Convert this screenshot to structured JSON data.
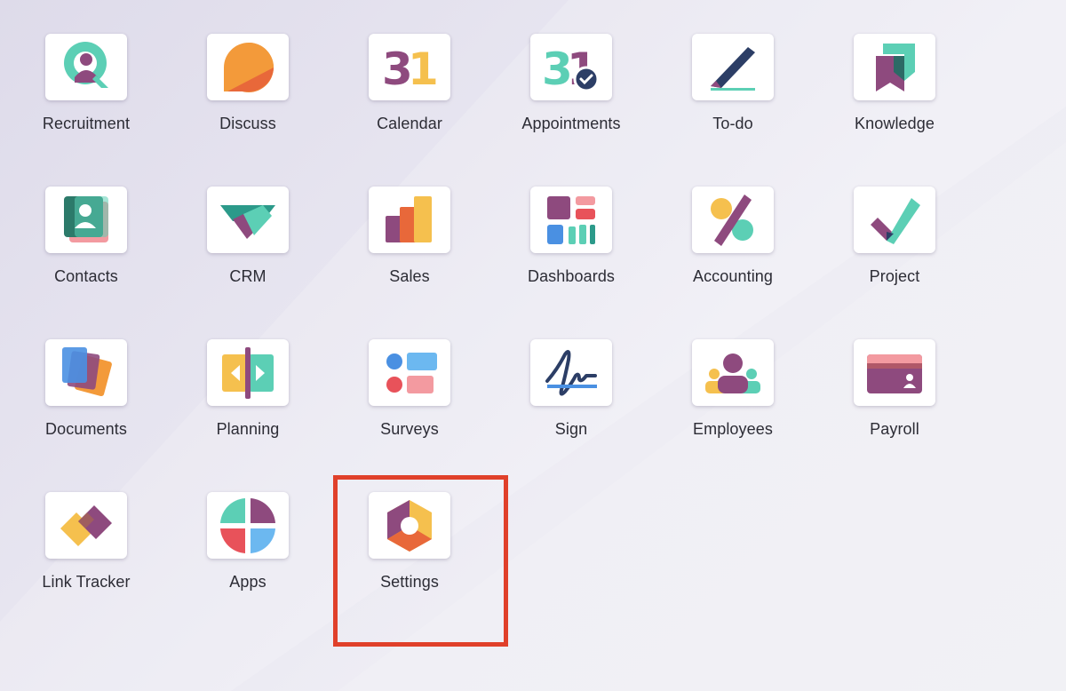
{
  "apps": [
    {
      "id": "recruitment",
      "label": "Recruitment",
      "icon": "recruitment-icon"
    },
    {
      "id": "discuss",
      "label": "Discuss",
      "icon": "discuss-icon"
    },
    {
      "id": "calendar",
      "label": "Calendar",
      "icon": "calendar-icon"
    },
    {
      "id": "appointments",
      "label": "Appointments",
      "icon": "appointments-icon"
    },
    {
      "id": "todo",
      "label": "To-do",
      "icon": "todo-icon"
    },
    {
      "id": "knowledge",
      "label": "Knowledge",
      "icon": "knowledge-icon"
    },
    {
      "id": "contacts",
      "label": "Contacts",
      "icon": "contacts-icon"
    },
    {
      "id": "crm",
      "label": "CRM",
      "icon": "crm-icon"
    },
    {
      "id": "sales",
      "label": "Sales",
      "icon": "sales-icon"
    },
    {
      "id": "dashboards",
      "label": "Dashboards",
      "icon": "dashboards-icon"
    },
    {
      "id": "accounting",
      "label": "Accounting",
      "icon": "accounting-icon"
    },
    {
      "id": "project",
      "label": "Project",
      "icon": "project-icon"
    },
    {
      "id": "documents",
      "label": "Documents",
      "icon": "documents-icon"
    },
    {
      "id": "planning",
      "label": "Planning",
      "icon": "planning-icon"
    },
    {
      "id": "surveys",
      "label": "Surveys",
      "icon": "surveys-icon"
    },
    {
      "id": "sign",
      "label": "Sign",
      "icon": "sign-icon"
    },
    {
      "id": "employees",
      "label": "Employees",
      "icon": "employees-icon"
    },
    {
      "id": "payroll",
      "label": "Payroll",
      "icon": "payroll-icon"
    },
    {
      "id": "link-tracker",
      "label": "Link Tracker",
      "icon": "link-tracker-icon"
    },
    {
      "id": "apps",
      "label": "Apps",
      "icon": "apps-icon"
    },
    {
      "id": "settings",
      "label": "Settings",
      "icon": "settings-icon"
    }
  ],
  "calendar_icon_text": "31",
  "highlight": {
    "target": "settings",
    "color": "#e0402a"
  },
  "colors": {
    "purple": "#8e4a7e",
    "teal": "#5ccfb5",
    "orange": "#f0863a",
    "yellow": "#f5c04e",
    "red": "#e8525a",
    "blue": "#4a90e2",
    "navy": "#2c3e66"
  }
}
